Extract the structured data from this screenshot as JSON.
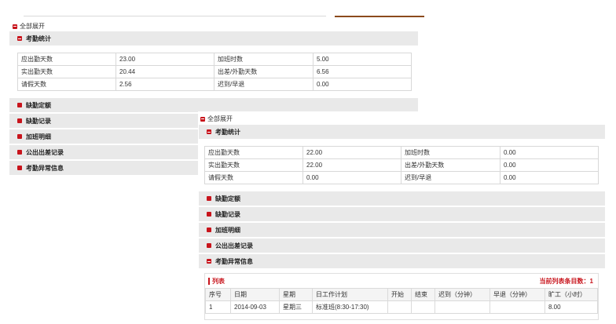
{
  "back_panel": {
    "expand_all": "全部展开",
    "sections": [
      "考勤统计",
      "缺勤定额",
      "缺勤记录",
      "加班明细",
      "公出出差记录",
      "考勤异常信息"
    ],
    "stats": [
      [
        "应出勤天数",
        "23.00",
        "加班时数",
        "5.00"
      ],
      [
        "实出勤天数",
        "20.44",
        "出差/外勤天数",
        "6.56"
      ],
      [
        "请假天数",
        "2.56",
        "迟到/早退",
        "0.00"
      ]
    ]
  },
  "front_panel": {
    "expand_all": "全部展开",
    "sections": [
      "考勤统计",
      "缺勤定额",
      "缺勤记录",
      "加班明细",
      "公出出差记录",
      "考勤异常信息"
    ],
    "stats": [
      [
        "应出勤天数",
        "22.00",
        "加班时数",
        "0.00"
      ],
      [
        "实出勤天数",
        "22.00",
        "出差/外勤天数",
        "0.00"
      ],
      [
        "请假天数",
        "0.00",
        "迟到/早退",
        "0.00"
      ]
    ],
    "list": {
      "title": "列表",
      "count_label": "当前列表条目数：1",
      "columns": [
        "序号",
        "日期",
        "星期",
        "日工作计划",
        "开始",
        "结束",
        "迟到（分钟）",
        "早退（分钟）",
        "旷工（小时）"
      ],
      "rows": [
        [
          "1",
          "2014-09-03",
          "星期三",
          "标准班(8:30-17:30)",
          "",
          "",
          "",
          "",
          "8.00"
        ]
      ]
    }
  },
  "colors": {
    "accent": "#c8141c",
    "section_bg": "#e9e9e9",
    "top_accent": "#8b4a1c"
  }
}
